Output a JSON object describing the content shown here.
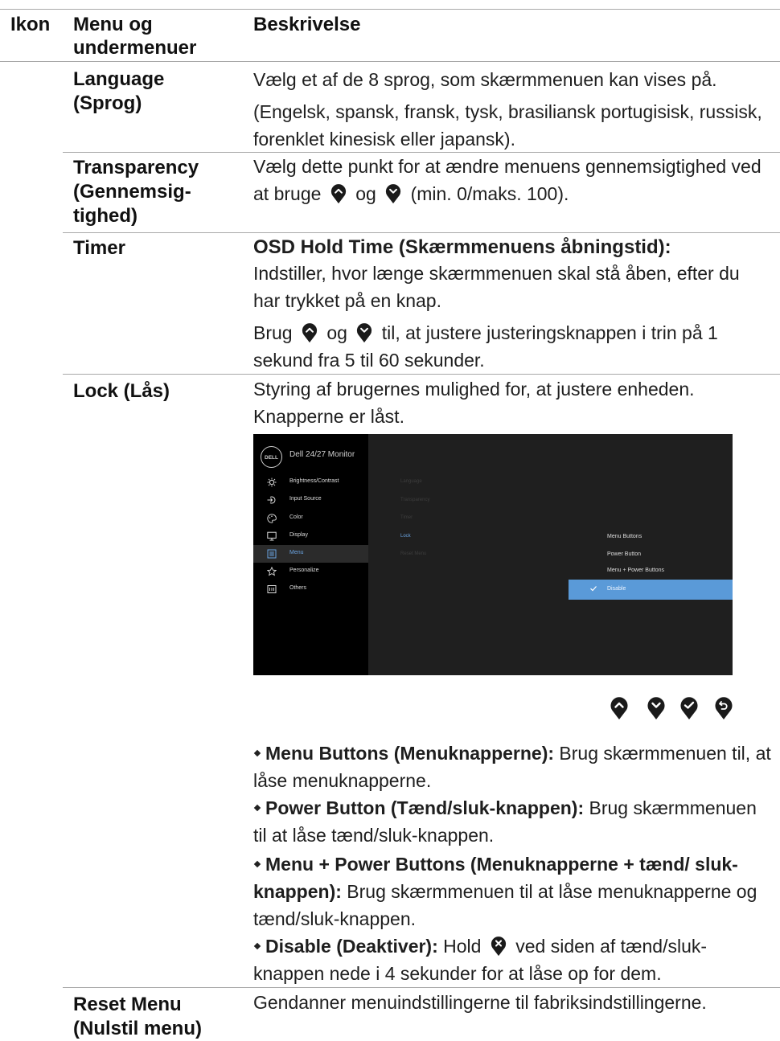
{
  "header": {
    "col_icon": "Ikon",
    "col_menu": "Menu og undermenuer",
    "col_desc": "Beskrivelse"
  },
  "rows": {
    "language": {
      "name": "Language (Sprog)",
      "line1": "Vælg et af de 8 sprog, som skærmmenuen kan vises på.",
      "line2": "(Engelsk, spansk, fransk, tysk, brasiliansk portugisisk, russisk, forenklet kinesisk eller japansk)."
    },
    "transparency": {
      "name": "Transparency (Gennemsig-tighed)",
      "text_a": "Vælg dette punkt for at ændre menuens gennemsigtighed ved at bruge",
      "text_b": "og",
      "text_c": "(min. 0/maks. 100)."
    },
    "timer": {
      "name": "Timer",
      "heading": "OSD Hold Time (Skærmmenuens åbningstid):",
      "text1": "Indstiller, hvor længe skærmmenuen skal stå åben, efter du har trykket på en knap.",
      "text2_a": "Brug",
      "text2_b": "og",
      "text2_c": "til, at justere justeringsknappen i trin på 1 sekund fra 5 til 60 sekunder."
    },
    "lock": {
      "name": "Lock (Lås)",
      "intro": "Styring af brugernes mulighed for, at justere enheden. Knapperne er låst.",
      "bullets": [
        {
          "bold": "Menu Buttons (Menuknapperne):",
          "text": " Brug skærmmenuen til, at låse menuknapperne."
        },
        {
          "bold": "Power Button (Tænd/sluk-knappen):",
          "text": " Brug skærmmenuen til at låse tænd/sluk-knappen."
        },
        {
          "bold": "Menu + Power Buttons (Menuknapperne + tænd/ sluk-knappen):",
          "text": " Brug skærmmenuen til at låse menuknapperne og tænd/sluk-knappen."
        }
      ],
      "disable_bold": "Disable (Deaktiver):",
      "disable_a": " Hold",
      "disable_b": "ved siden af tænd/sluk-knappen nede i 4 sekunder for at låse op for dem."
    },
    "reset": {
      "name": "Reset Menu (Nulstil menu)",
      "text": "Gendanner menuindstillingerne til fabriksindstillingerne."
    }
  },
  "osd": {
    "logo": "DELL",
    "title": "Dell 24/27 Monitor",
    "menu": [
      {
        "label": "Brightness/Contrast",
        "icon": "brightness-icon"
      },
      {
        "label": "Input Source",
        "icon": "input-source-icon"
      },
      {
        "label": "Color",
        "icon": "color-palette-icon"
      },
      {
        "label": "Display",
        "icon": "display-monitor-icon"
      },
      {
        "label": "Menu",
        "icon": "menu-list-icon"
      },
      {
        "label": "Personalize",
        "icon": "star-icon"
      },
      {
        "label": "Others",
        "icon": "others-icon"
      }
    ],
    "submenu": [
      "Language",
      "Transparency",
      "Timer",
      "Lock",
      "Reset Menu"
    ],
    "options": [
      "Menu Buttons",
      "Power Button",
      "Menu + Power Buttons"
    ],
    "selected_option": "Disable"
  },
  "controls": [
    "up-button-icon",
    "down-button-icon",
    "check-button-icon",
    "back-button-icon"
  ],
  "colors": {
    "accent_blue": "#5a9ad8",
    "rule": "#a8a8a8"
  }
}
